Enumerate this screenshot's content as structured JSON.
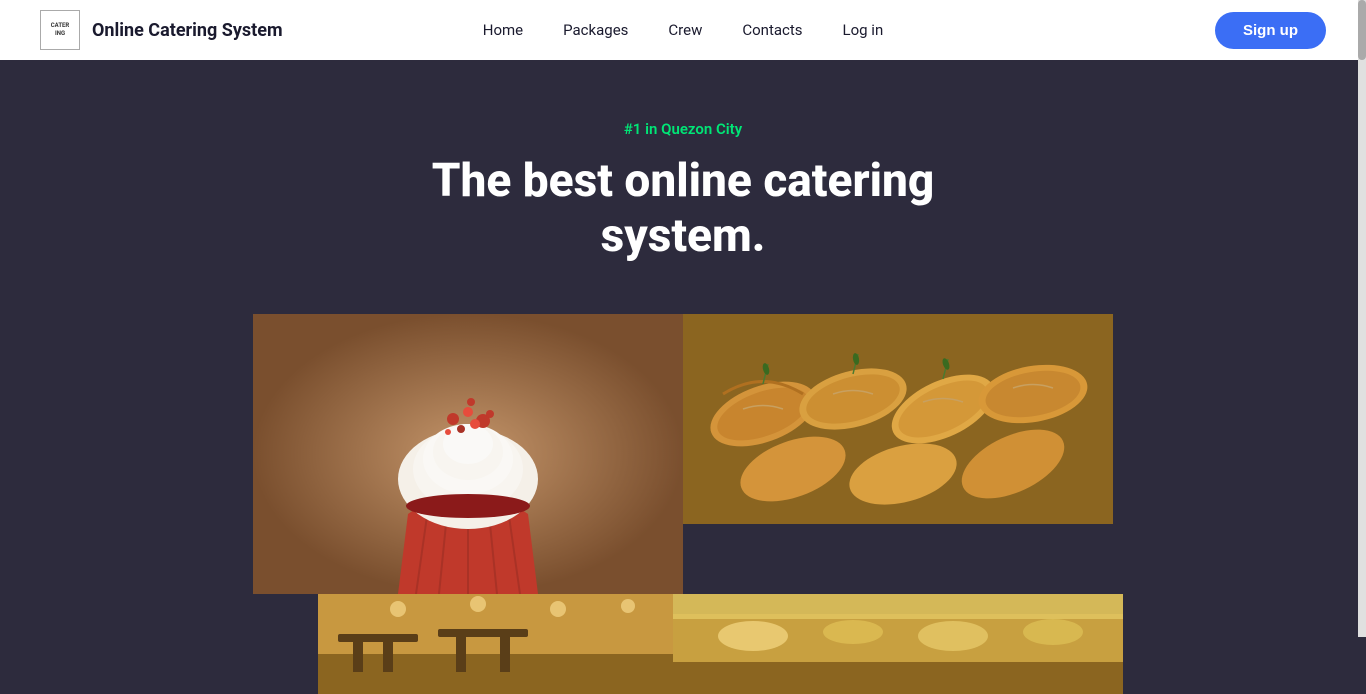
{
  "navbar": {
    "logo_text": "CATER\nING",
    "brand_name": "Online Catering System",
    "nav_links": [
      {
        "label": "Home",
        "id": "home"
      },
      {
        "label": "Packages",
        "id": "packages"
      },
      {
        "label": "Crew",
        "id": "crew"
      },
      {
        "label": "Contacts",
        "id": "contacts"
      },
      {
        "label": "Log in",
        "id": "login"
      }
    ],
    "signup_label": "Sign up"
  },
  "hero": {
    "tagline": "#1 in Quezon City",
    "title_line1": "The best online catering",
    "title_line2": "system."
  },
  "images": {
    "cupcake_alt": "Red velvet cupcake",
    "croissants_alt": "Catering croissants",
    "interior_alt": "Venue interior",
    "table_alt": "Catering table setup"
  }
}
